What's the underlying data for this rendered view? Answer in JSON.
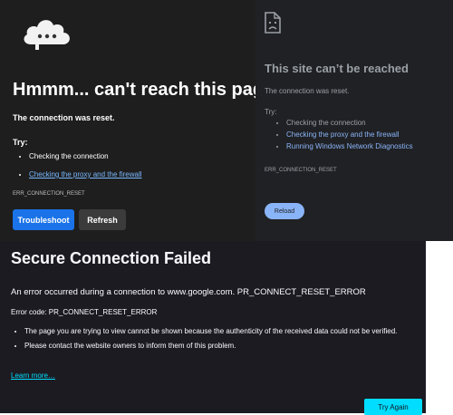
{
  "edge": {
    "title": "Hmmm... can't reach this page",
    "subtitle": "The connection was reset.",
    "try_label": "Try:",
    "suggestions": [
      {
        "text": "Checking the connection",
        "is_link": false
      },
      {
        "text": "Checking the proxy and the firewall",
        "is_link": true
      }
    ],
    "error_code": "ERR_CONNECTION_RESET",
    "troubleshoot_label": "Troubleshoot",
    "refresh_label": "Refresh",
    "icon": "cloud-icon"
  },
  "chrome": {
    "title": "This site can’t be reached",
    "subtitle": "The connection was reset.",
    "try_label": "Try:",
    "suggestions": [
      {
        "text": "Checking the connection",
        "is_link": false
      },
      {
        "text": "Checking the proxy and the firewall",
        "is_link": true
      },
      {
        "text": "Running Windows Network Diagnostics",
        "is_link": true
      }
    ],
    "error_code": "ERR_CONNECTION_RESET",
    "reload_label": "Reload",
    "icon": "sad-document-icon"
  },
  "firefox": {
    "title": "Secure Connection Failed",
    "subtitle": "An error occurred during a connection to www.google.com. PR_CONNECT_RESET_ERROR",
    "error_code_line": "Error code: PR_CONNECT_RESET_ERROR",
    "bullets": [
      "The page you are trying to view cannot be shown because the authenticity of the received data could not be verified.",
      "Please contact the website owners to inform them of this problem."
    ],
    "learn_more": "Learn more…",
    "try_again_label": "Try Again"
  },
  "colors": {
    "edge_bg": "#1e1e1e",
    "chrome_bg": "#202124",
    "firefox_bg": "#1c1b22",
    "edge_accent": "#1a73e8",
    "chrome_accent": "#8ab4f8",
    "firefox_accent": "#00ddff"
  }
}
